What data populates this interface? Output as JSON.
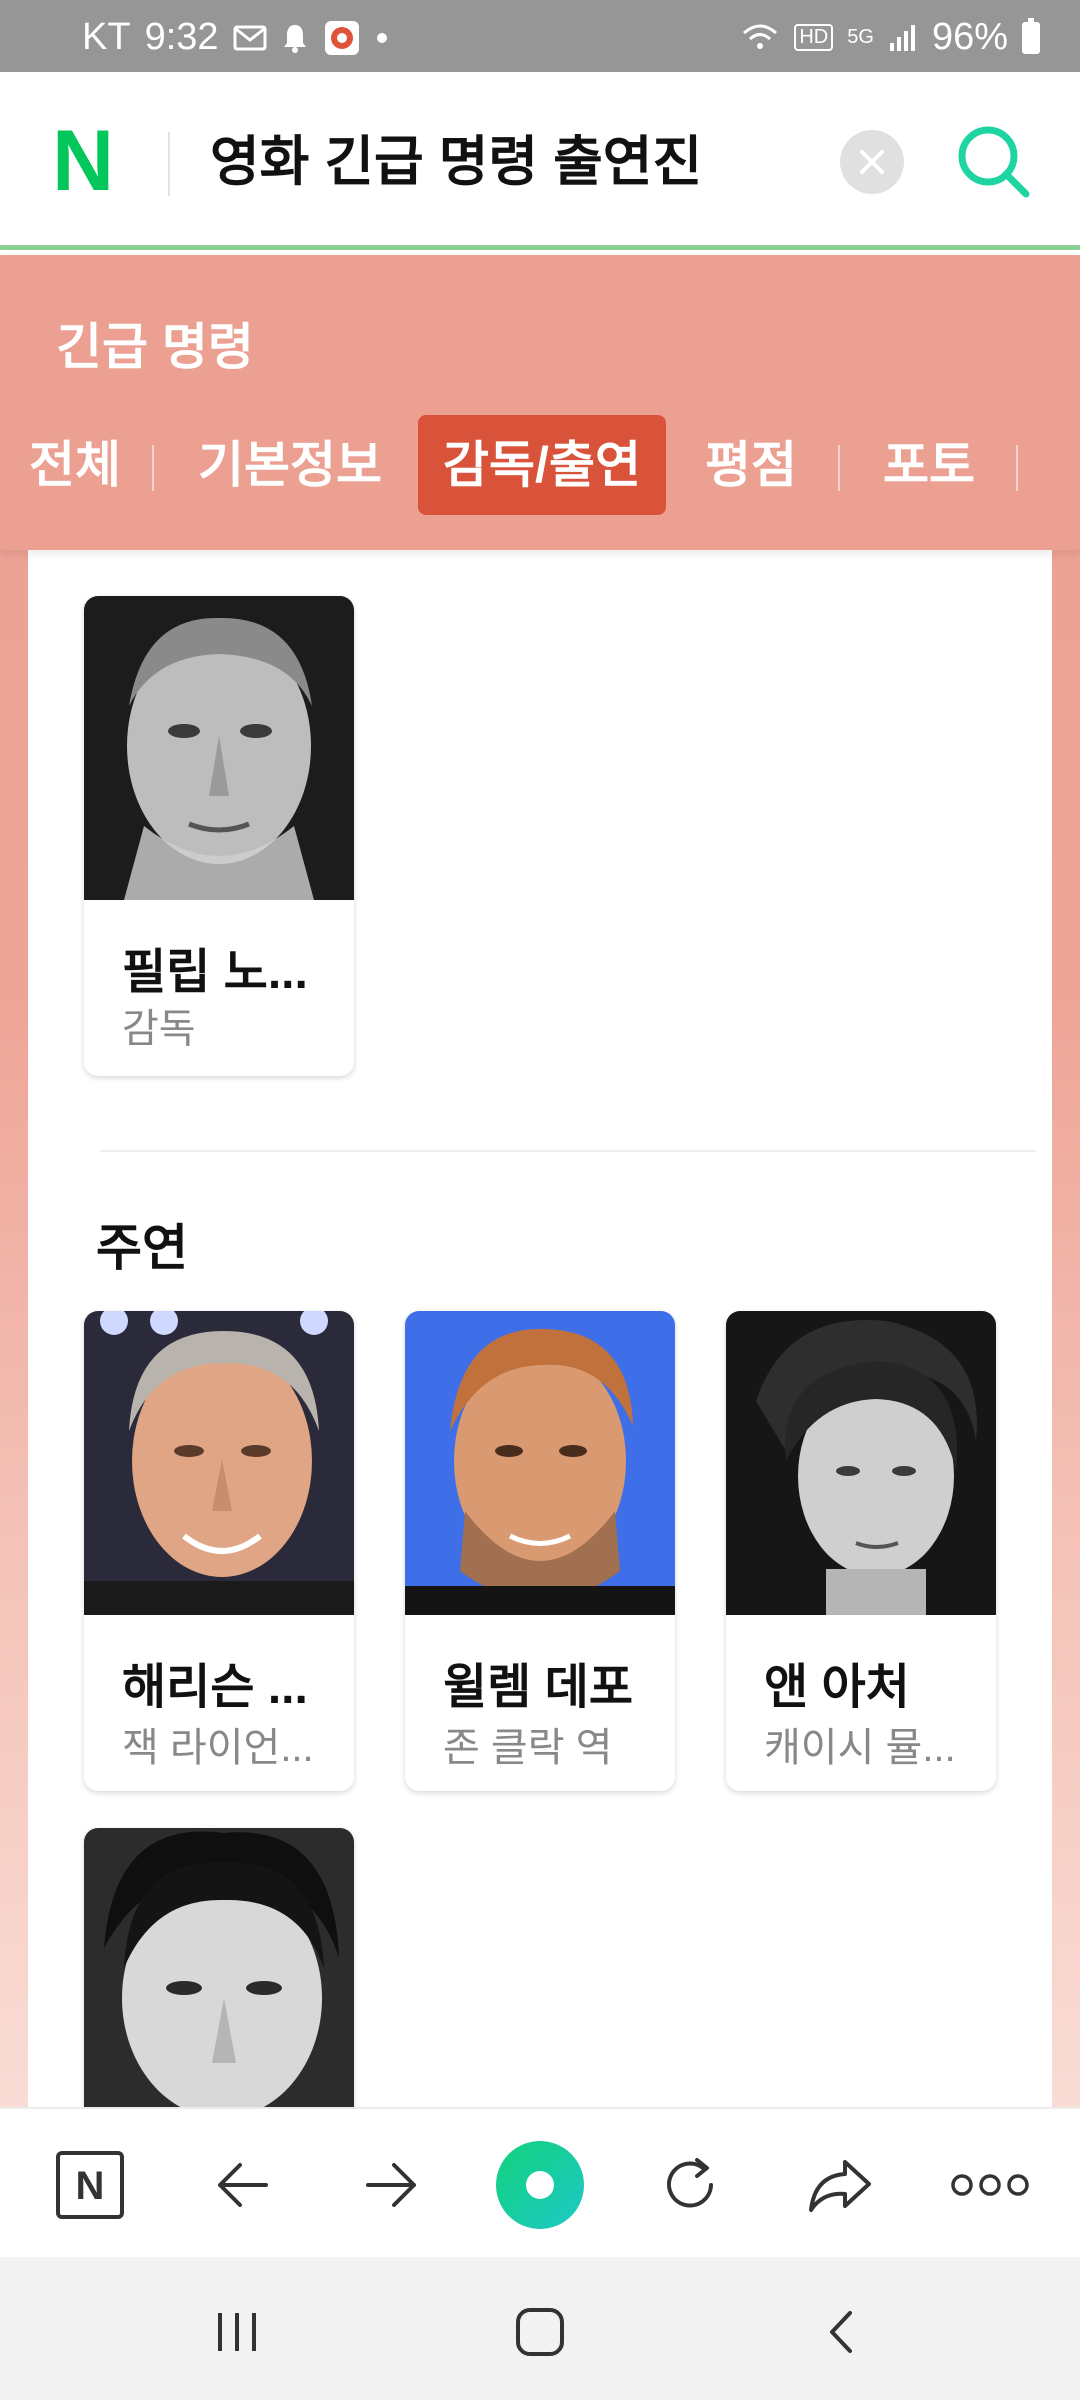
{
  "status_bar": {
    "carrier": "KT",
    "time": "9:32",
    "battery": "96%",
    "network": "5G",
    "hd_badge": "HD"
  },
  "search": {
    "logo": "N",
    "query": "영화 긴급 명령 출연진"
  },
  "panel": {
    "title": "긴급 명령",
    "tabs": [
      {
        "label": "전체",
        "active": false
      },
      {
        "label": "기본정보",
        "active": false
      },
      {
        "label": "감독/출연",
        "active": true
      },
      {
        "label": "평점",
        "active": false
      },
      {
        "label": "포토",
        "active": false
      }
    ]
  },
  "director": {
    "name": "필립 노...",
    "role": "감독"
  },
  "lead_section": {
    "title": "주연",
    "people": [
      {
        "name": "해리슨 ...",
        "role": "잭 라이언..."
      },
      {
        "name": "윌렘 데포",
        "role": "존 클락 역"
      },
      {
        "name": "앤 아처",
        "role": "캐이시 뮬..."
      },
      {
        "name": "",
        "role": ""
      }
    ]
  },
  "browser_bar": {
    "home_logo": "N",
    "icons": [
      "naver-home-icon",
      "back-arrow-icon",
      "forward-arrow-icon",
      "green-dot-icon",
      "refresh-icon",
      "share-icon",
      "more-icon"
    ]
  },
  "android_nav": {
    "icons": [
      "recent-apps-icon",
      "home-icon",
      "back-icon"
    ]
  },
  "colors": {
    "panel": "#eba092",
    "active_tab": "#d9533a",
    "naver_green": "#03c75a",
    "search_accent": "#1ed4a0"
  }
}
